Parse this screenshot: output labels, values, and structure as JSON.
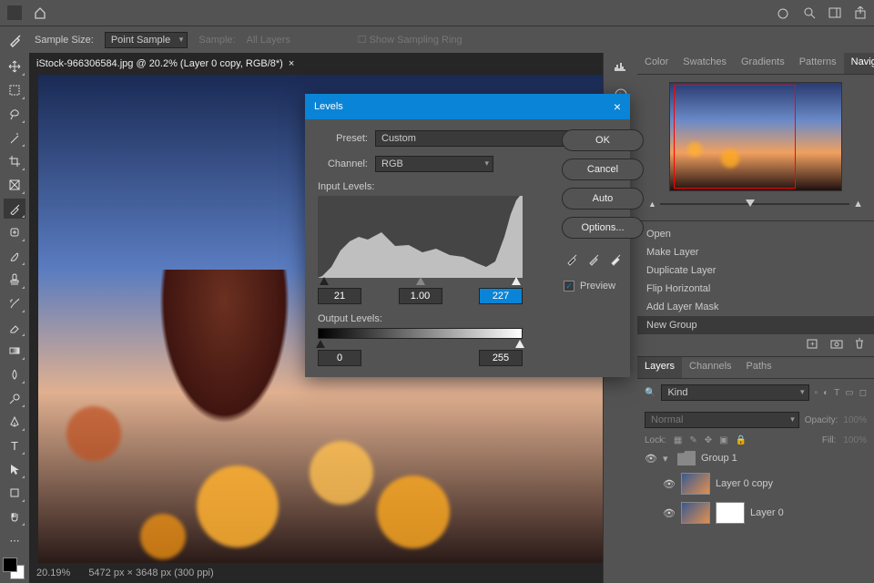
{
  "menubar": {
    "home": "⌂"
  },
  "optionbar": {
    "sample_size_label": "Sample Size:",
    "sample_size_value": "Point Sample",
    "sample_label": "Sample:",
    "sample_value": "All Layers",
    "sampling_ring": "Show Sampling Ring"
  },
  "doc": {
    "tab_title": "iStock-966306584.jpg @ 20.2% (Layer 0 copy, RGB/8*)",
    "zoom": "20.19%",
    "dims": "5472 px × 3648 px (300 ppi)"
  },
  "panels": {
    "color_tabs": [
      "Color",
      "Swatches",
      "Gradients",
      "Patterns",
      "Navigator"
    ],
    "active_color_tab": "Navigator",
    "history": {
      "items": [
        "Open",
        "Make Layer",
        "Duplicate Layer",
        "Flip Horizontal",
        "Add Layer Mask",
        "New Group"
      ],
      "selected": "New Group"
    },
    "layer_tabs": [
      "Layers",
      "Channels",
      "Paths"
    ],
    "kind_label": "Kind",
    "blend_mode": "Normal",
    "opacity_label": "Opacity:",
    "opacity_value": "100%",
    "lock_label": "Lock:",
    "fill_label": "Fill:",
    "fill_value": "100%",
    "layers": [
      {
        "name": "Group 1",
        "type": "group"
      },
      {
        "name": "Layer 0 copy",
        "type": "pixel"
      },
      {
        "name": "Layer 0",
        "type": "masked"
      }
    ]
  },
  "dialog": {
    "title": "Levels",
    "preset_label": "Preset:",
    "preset_value": "Custom",
    "channel_label": "Channel:",
    "channel_value": "RGB",
    "input_label": "Input Levels:",
    "in_black": "21",
    "in_gamma": "1.00",
    "in_white": "227",
    "output_label": "Output Levels:",
    "out_black": "0",
    "out_white": "255",
    "ok": "OK",
    "cancel": "Cancel",
    "auto": "Auto",
    "options": "Options...",
    "preview_label": "Preview"
  }
}
